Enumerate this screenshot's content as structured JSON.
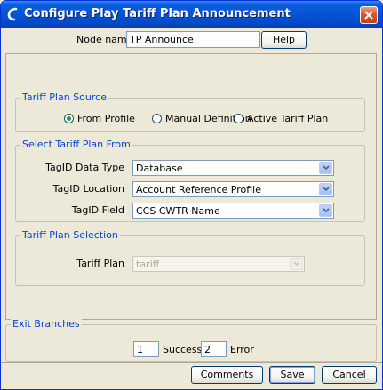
{
  "window": {
    "title": "Configure Play Tariff Plan Announcement"
  },
  "node": {
    "label": "Node name",
    "value": "TP Announce",
    "help_label": "Help"
  },
  "source": {
    "legend": "Tariff Plan Source",
    "options": [
      {
        "label": "From Profile",
        "selected": true
      },
      {
        "label": "Manual Definition",
        "selected": false
      },
      {
        "label": "Active Tariff Plan",
        "selected": false
      }
    ]
  },
  "select_from": {
    "legend": "Select Tariff Plan From",
    "data_type": {
      "label": "TagID Data Type",
      "value": "Database"
    },
    "location": {
      "label": "TagID Location",
      "value": "Account Reference Profile"
    },
    "field": {
      "label": "TagID Field",
      "value": "CCS CWTR Name"
    }
  },
  "selection": {
    "legend": "Tariff Plan Selection",
    "tariff_plan": {
      "label": "Tariff Plan",
      "value": "tariff",
      "enabled": false
    }
  },
  "exit": {
    "legend": "Exit Branches",
    "success": {
      "number": "1",
      "label": "Success"
    },
    "error": {
      "number": "2",
      "label": "Error"
    }
  },
  "buttons": {
    "comments": "Comments",
    "save": "Save",
    "cancel": "Cancel"
  },
  "colors": {
    "title_bar": "#0554d6",
    "legend_text": "#0046d5",
    "face": "#ece9d8"
  }
}
